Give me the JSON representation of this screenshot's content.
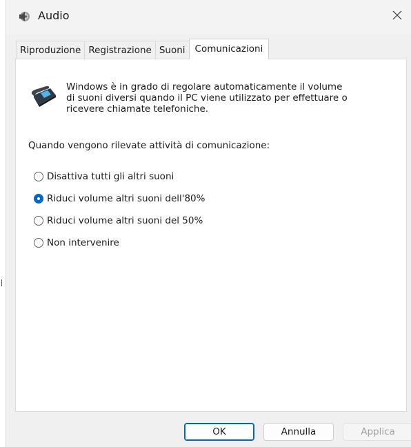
{
  "window": {
    "title": "Audio",
    "app_icon": "speaker-icon",
    "close_icon": "close-icon"
  },
  "tabs": [
    {
      "label": "Riproduzione",
      "active": false
    },
    {
      "label": "Registrazione",
      "active": false
    },
    {
      "label": "Suoni",
      "active": false
    },
    {
      "label": "Comunicazioni",
      "active": true
    }
  ],
  "panel": {
    "icon": "telephone-icon",
    "description_lines": [
      "Windows è in grado di regolare automaticamente il volume",
      "di suoni diversi quando il PC viene utilizzato per effettuare o",
      "ricevere chiamate telefoniche."
    ],
    "question": "Quando vengono rilevate attività di comunicazione:",
    "options": [
      {
        "label": "Disattiva tutti gli altri suoni",
        "checked": false
      },
      {
        "label": "Riduci volume altri suoni dell'80%",
        "checked": true
      },
      {
        "label": "Riduci volume altri suoni del 50%",
        "checked": false
      },
      {
        "label": "Non intervenire",
        "checked": false
      }
    ]
  },
  "buttons": {
    "ok": "OK",
    "cancel": "Annulla",
    "apply": "Applica"
  },
  "colors": {
    "accent": "#0067c0",
    "panel_bg": "#ffffff",
    "window_bg": "#f0f0f0"
  }
}
